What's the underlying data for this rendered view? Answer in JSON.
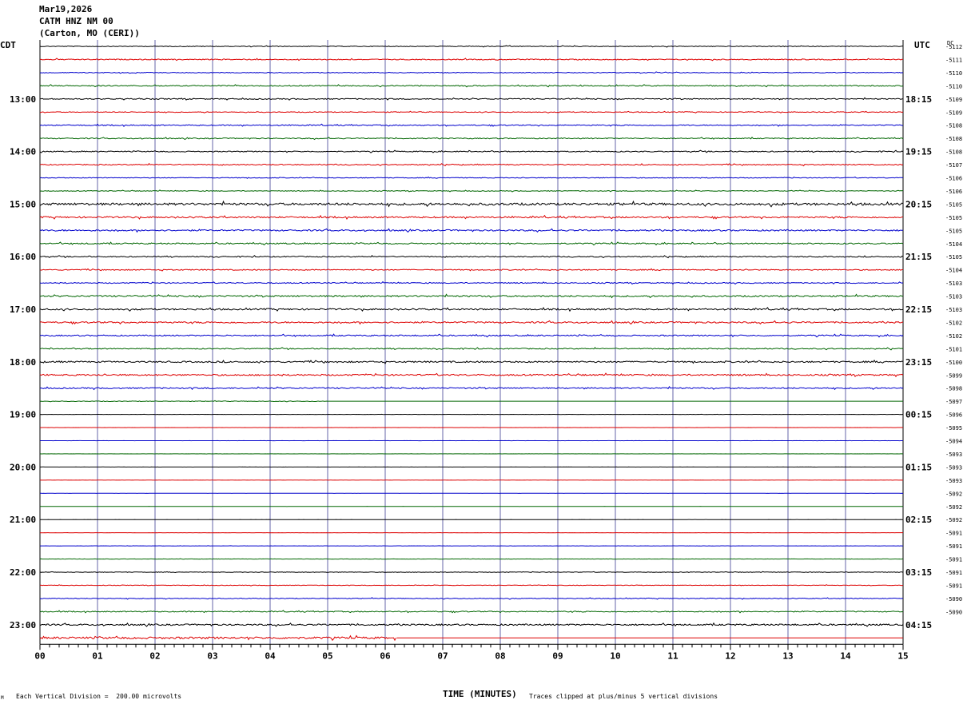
{
  "header": {
    "date": "Mar19,2026",
    "channel": "CATM HNZ NM 00",
    "location": "(Carton, MO (CERI))"
  },
  "left_tz": "CDT",
  "right_tz": "UTC",
  "dc_label": "DC",
  "footer": {
    "scale_note": "Each Vertical Division =  200.00 microvolts",
    "xlabel": "TIME (MINUTES)",
    "clip_note": "Traces clipped at plus/minus 5 vertical divisions",
    "corner_mark": "M"
  },
  "colors": {
    "trace_cycle": [
      "#000000",
      "#dd0000",
      "#0000cc",
      "#006600"
    ],
    "grid": "#6666aa"
  },
  "chart_data": {
    "type": "line",
    "title": "CATM HNZ NM 00",
    "xlabel": "TIME (MINUTES)",
    "xlim": [
      0,
      15
    ],
    "x_ticks": [
      "00",
      "01",
      "02",
      "03",
      "04",
      "05",
      "06",
      "07",
      "08",
      "09",
      "10",
      "11",
      "12",
      "13",
      "14",
      "15"
    ],
    "rows_per_hour": 4,
    "minutes_per_row": 15,
    "left_hour_labels": [
      "13:00",
      "14:00",
      "15:00",
      "16:00",
      "17:00",
      "18:00",
      "19:00",
      "20:00",
      "21:00",
      "22:00",
      "23:00"
    ],
    "right_hour_labels": [
      "18:15",
      "19:15",
      "20:15",
      "21:15",
      "22:15",
      "23:15",
      "00:15",
      "01:15",
      "02:15",
      "03:15",
      "04:15"
    ],
    "dc_offsets": [
      "-5112",
      "-5111",
      "-5110",
      "-5110",
      "-5109",
      "-5109",
      "-5108",
      "-5108",
      "-5108",
      "-5107",
      "-5106",
      "-5106",
      "-5105",
      "-5105",
      "-5105",
      "-5104",
      "-5105",
      "-5104",
      "-5103",
      "-5103",
      "-5103",
      "-5102",
      "-5102",
      "-5101",
      "-5100",
      "-5099",
      "-5098",
      "-5097",
      "-5096",
      "-5095",
      "-5094",
      "-5093",
      "-5093",
      "-5093",
      "-5092",
      "-5092",
      "-5092",
      "-5091",
      "-5091",
      "-5091",
      "-5091",
      "-5091",
      "-5090",
      "-5090"
    ],
    "trace_levels": [
      0.15,
      0.2,
      0.15,
      0.2,
      0.2,
      0.15,
      0.2,
      0.2,
      0.2,
      0.2,
      0.15,
      0.15,
      0.45,
      0.3,
      0.3,
      0.25,
      0.2,
      0.2,
      0.2,
      0.3,
      0.3,
      0.3,
      0.25,
      0.2,
      0.3,
      0.3,
      0.25,
      0.12,
      0.03,
      0.02,
      0.02,
      0.02,
      0.02,
      0.02,
      0.02,
      0.02,
      0.02,
      0.02,
      0.03,
      0.05,
      0.1,
      0.1,
      0.15,
      0.2,
      0.3,
      0.4
    ],
    "trace_end_minute": [
      15,
      15,
      15,
      15,
      15,
      15,
      15,
      15,
      15,
      15,
      15,
      15,
      15,
      15,
      15,
      15,
      15,
      15,
      15,
      15,
      15,
      15,
      15,
      15,
      15,
      15,
      15,
      5,
      15,
      15,
      15,
      15,
      15,
      15,
      15,
      15,
      15,
      15,
      15,
      15,
      15,
      15,
      15,
      15,
      15,
      6.2
    ],
    "units": "microvolts",
    "division_value": 200.0,
    "clip_divisions": 5
  }
}
